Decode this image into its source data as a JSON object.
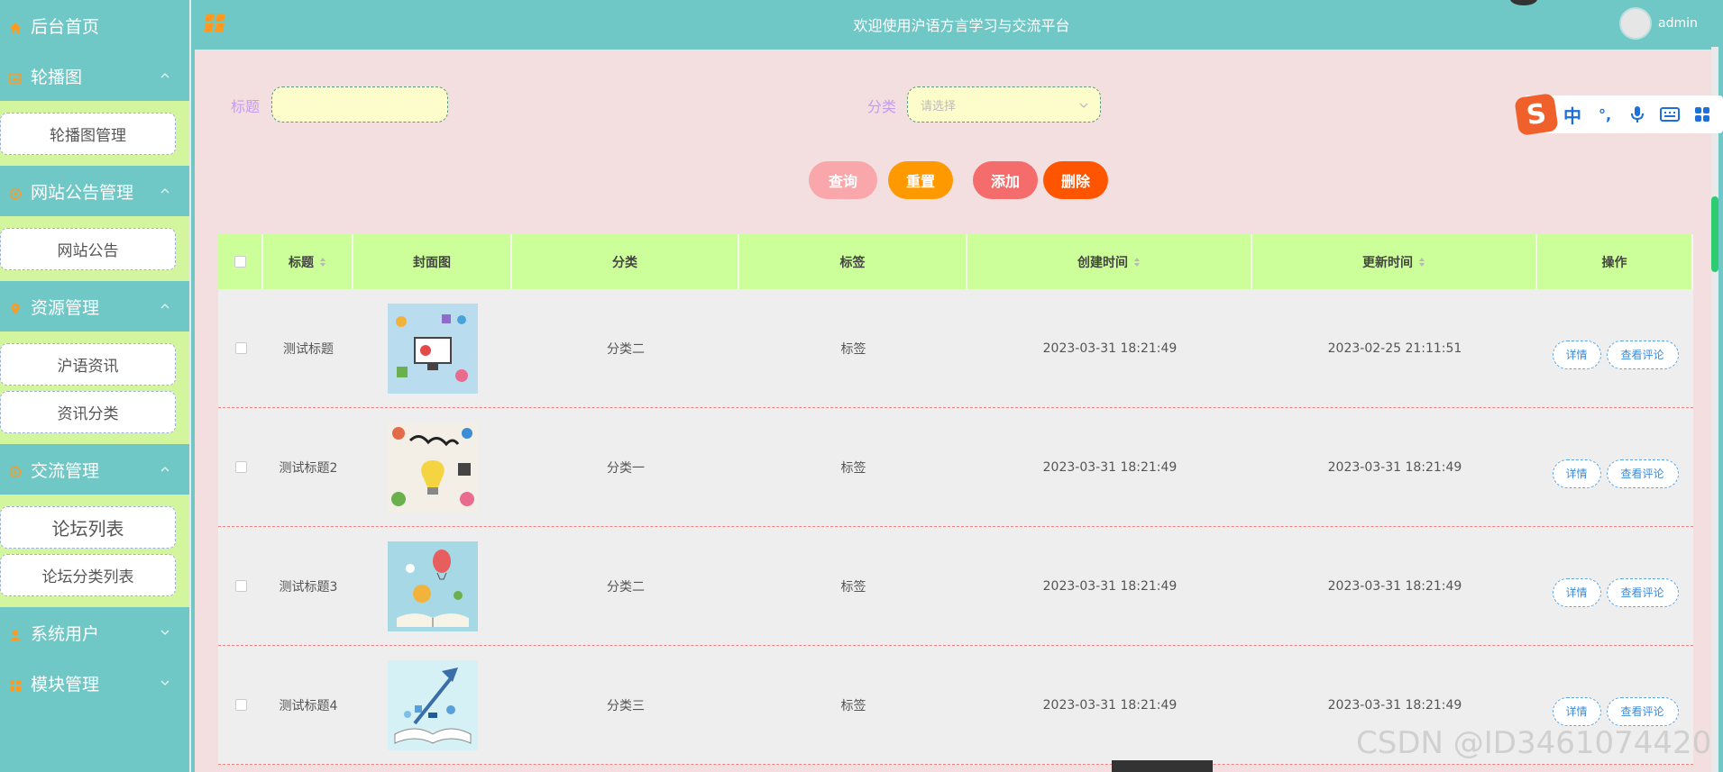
{
  "sidebar": {
    "home_label": "后台首页",
    "groups": [
      {
        "label": "轮播图",
        "icon": "image-icon",
        "items": [
          "轮播图管理"
        ]
      },
      {
        "label": "网站公告管理",
        "icon": "notice-icon",
        "items": [
          "网站公告"
        ]
      },
      {
        "label": "资源管理",
        "icon": "location-icon",
        "items": [
          "沪语资讯",
          "资讯分类"
        ]
      },
      {
        "label": "交流管理",
        "icon": "chat-icon",
        "items": [
          "论坛列表",
          "论坛分类列表"
        ]
      }
    ],
    "collapsed": [
      {
        "label": "系统用户",
        "icon": "user-icon"
      },
      {
        "label": "模块管理",
        "icon": "module-icon"
      }
    ]
  },
  "header": {
    "title": "欢迎使用沪语方言学习与交流平台",
    "username": "admin"
  },
  "search": {
    "title_label": "标题",
    "title_value": "",
    "category_label": "分类",
    "category_placeholder": "请选择"
  },
  "buttons": {
    "query": "查询",
    "reset": "重置",
    "add": "添加",
    "delete": "删除"
  },
  "colors": {
    "query_button": "#f9a7aa",
    "reset_button": "#ff9900",
    "add_button": "#f56c6c",
    "delete_button": "#ff5500",
    "accent": "#6fc8c6"
  },
  "table": {
    "columns": [
      "标题",
      "封面图",
      "分类",
      "标签",
      "创建时间",
      "更新时间",
      "操作"
    ],
    "rows": [
      {
        "title": "测试标题",
        "category": "分类二",
        "tag": "标签",
        "created": "2023-03-31 18:21:49",
        "updated": "2023-02-25 21:11:51"
      },
      {
        "title": "测试标题2",
        "category": "分类一",
        "tag": "标签",
        "created": "2023-03-31 18:21:49",
        "updated": "2023-03-31 18:21:49"
      },
      {
        "title": "测试标题3",
        "category": "分类二",
        "tag": "标签",
        "created": "2023-03-31 18:21:49",
        "updated": "2023-03-31 18:21:49"
      },
      {
        "title": "测试标题4",
        "category": "分类三",
        "tag": "标签",
        "created": "2023-03-31 18:21:49",
        "updated": "2023-03-31 18:21:49"
      }
    ],
    "row_actions": {
      "detail": "详情",
      "comments": "查看评论"
    }
  },
  "ime": {
    "logo": "S",
    "mode": "中",
    "punct": "°,"
  },
  "watermark": "CSDN @ID3461074420"
}
